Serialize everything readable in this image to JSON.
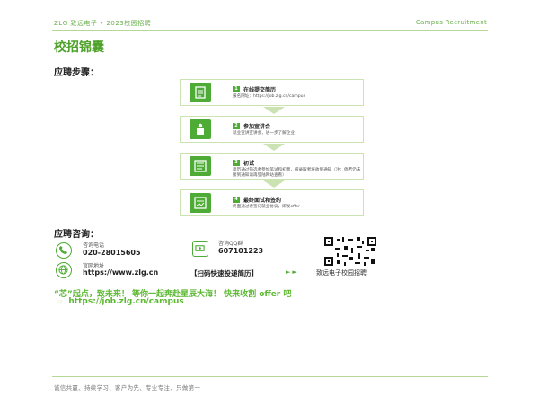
{
  "header": {
    "left": "ZLG 致远电子 • 2023校园招聘",
    "right": "Campus Recruitment"
  },
  "section_title": "校招锦囊",
  "process_heading": "应聘步骤：",
  "steps": [
    {
      "num": "1",
      "title": "在线提交简历",
      "desc": "报名网址：https://job.zlg.cn/campus"
    },
    {
      "num": "2",
      "title": "参加宣讲会",
      "desc": "就业宣讲宣讲会，进一步了解企业"
    },
    {
      "num": "3",
      "title": "初试",
      "desc": "简历通过筛选者参加笔试和初面，被录取者将收到通知（注：倘若仍未接到通知请再登陆网站查看）"
    },
    {
      "num": "4",
      "title": "最终面试和签约",
      "desc": "终面通过者签订就业协议，即发offer"
    }
  ],
  "consult_heading": "应聘咨询：",
  "contacts": {
    "phone_label": "咨询电话",
    "phone_value": "020-28015605",
    "qq_label": "咨询QQ群",
    "qq_value": "607101223",
    "web_label": "官网地址",
    "web_value": "https://www.zlg.cn"
  },
  "scan_text": "【扫码快速投递简历】",
  "arrows_glyph": "►►",
  "wechat_label": "致远电子校园招聘",
  "slogan": "“芯”起点，致未来！ 等你一起奔赴星辰大海！ 快来收割 offer 吧",
  "url_line": "https://job.zlg.cn/campus",
  "footer": "诚信共赢、持续学习、客户为先、专业专注、只做第一",
  "colors": {
    "accent": "#4eab35",
    "slogan": "#5cb832"
  }
}
